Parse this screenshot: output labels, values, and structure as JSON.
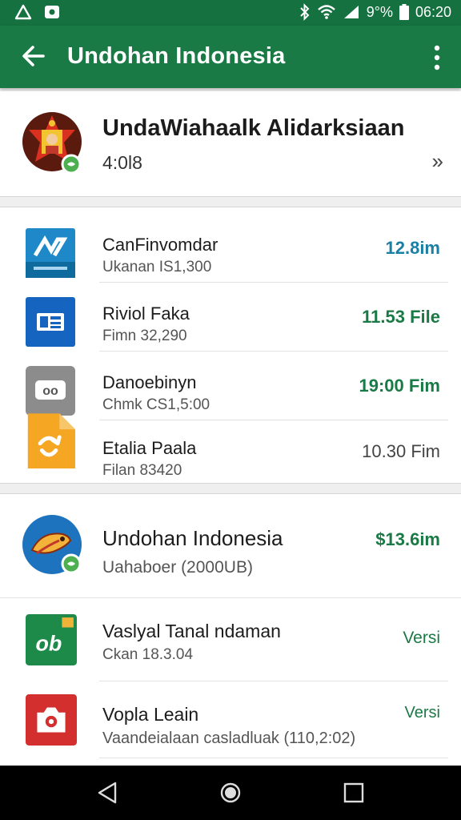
{
  "status_bar": {
    "battery_text": "9°%",
    "time": "06:20",
    "icons": [
      "warning-icon",
      "app-icon",
      "bluetooth-icon",
      "wifi-icon",
      "signal-icon",
      "battery-icon"
    ]
  },
  "app_bar": {
    "title": "Undohan Indonesia",
    "back_icon": "arrow-left-icon",
    "menu_icon": "more-vert-icon"
  },
  "hero": {
    "title": "UndaWiahaalk Alidarksiaan",
    "subtitle": "4:0l8",
    "chevron": "»"
  },
  "list1": [
    {
      "name": "CanFinvomdar",
      "sub": "Ukanan IS1,300",
      "size": "12.8im",
      "size_color": "#1a7fa5",
      "icon": "blue-a-icon"
    },
    {
      "name": "Riviol Faka",
      "sub": "Fimn 32,290",
      "size": "11.53 File",
      "size_color": "#1a7a45",
      "icon": "blue-card-icon"
    },
    {
      "name": "Danoebinyn",
      "sub": "Chmk CS1,5:00",
      "size": "19:00 Fim",
      "size_color": "#1a7a45",
      "icon": "gray-chat-icon"
    },
    {
      "name": "Etalia Paala",
      "sub": "Filan 83420",
      "size": "10.30 Fim",
      "size_color": "#444444",
      "icon": "orange-file-icon"
    }
  ],
  "list2": [
    {
      "name": "Undohan Indonesia",
      "sub": "Uahaboer (2000UB)",
      "size": "$13.6im",
      "size_color": "#1a7a45",
      "icon": "fish-icon"
    },
    {
      "name": "Vaslyal Tanal ndaman",
      "sub": "Ckan 18.3.04",
      "size": "Versi",
      "size_color": "#1a7a45",
      "icon": "green-ob-icon"
    },
    {
      "name": "Vopla Leain",
      "sub": "Vaandeialaan casladluak (110,2:02)",
      "size": "Versi",
      "size_color": "#1a7a45",
      "icon": "red-camera-icon"
    }
  ],
  "nav": {
    "back": "nav-back-icon",
    "home": "nav-home-icon",
    "recents": "nav-recents-icon"
  }
}
